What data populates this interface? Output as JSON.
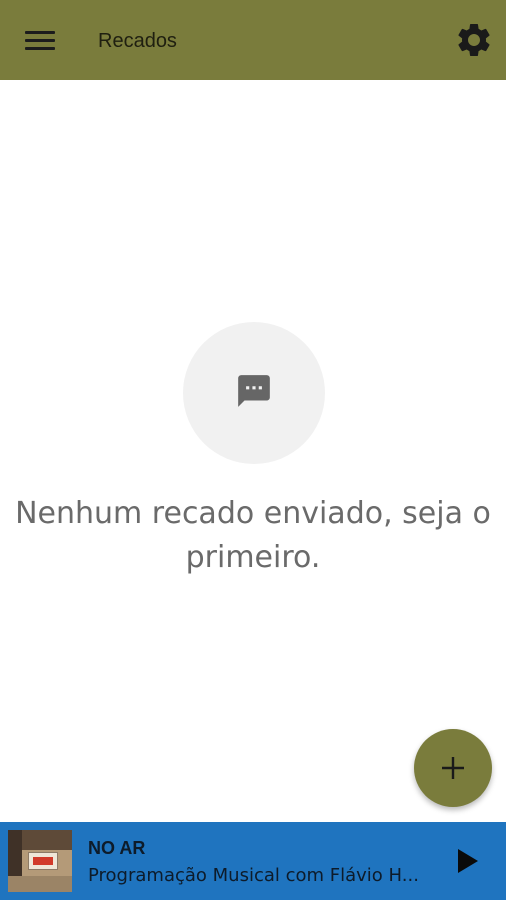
{
  "appbar": {
    "title": "Recados",
    "background": "#7a7c3c",
    "menu_icon": "hamburger-menu-icon",
    "settings_icon": "gear-icon"
  },
  "empty_state": {
    "icon": "chat-bubble-icon",
    "message": "Nenhum recado enviado, seja o primeiro."
  },
  "fab": {
    "icon": "plus-icon",
    "color": "#7a7c3c"
  },
  "player": {
    "status": "NO AR",
    "program": "Programação Musical com Flávio H...",
    "background": "#1f74bf",
    "play_icon": "play-icon"
  }
}
